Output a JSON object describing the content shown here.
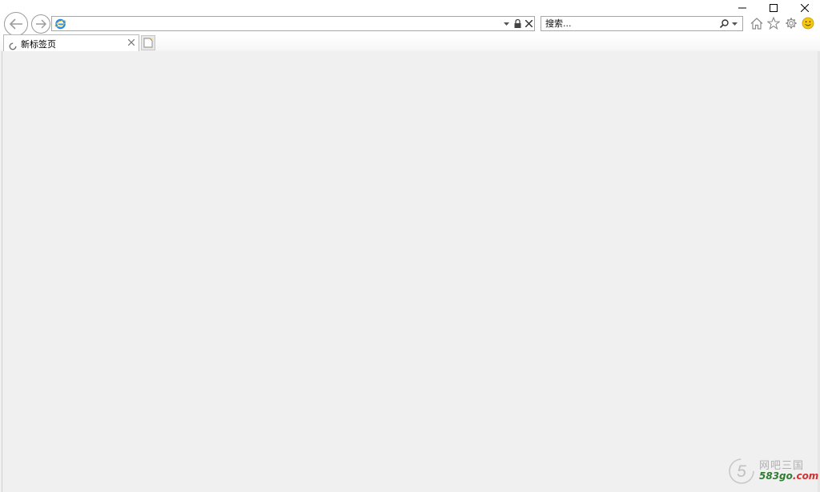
{
  "window": {
    "minimize_icon": "minimize-icon",
    "maximize_icon": "maximize-icon",
    "close_icon": "close-icon"
  },
  "toolbar": {
    "back_icon": "back-arrow-icon",
    "forward_icon": "forward-arrow-icon",
    "address": {
      "value": "",
      "site_icon": "internet-explorer-icon",
      "dropdown_icon": "dropdown-arrow-icon",
      "lock_icon": "lock-icon",
      "stop_icon": "close-icon"
    },
    "search": {
      "placeholder": "搜索...",
      "search_icon": "search-icon",
      "dropdown_icon": "dropdown-arrow-icon"
    },
    "home_icon": "home-icon",
    "favorites_icon": "star-icon",
    "tools_icon": "gear-icon",
    "feedback_icon": "smiley-icon"
  },
  "tabs": [
    {
      "title": "新标签页",
      "loading": true
    }
  ],
  "new_tab_icon": "new-tab-icon",
  "watermark": {
    "logo_glyph": "5",
    "site_name": "网吧三国",
    "url_main": "583go",
    "url_tld": ".com"
  },
  "colors": {
    "ie_blue": "#1e88e5",
    "ie_ring": "#f5b400",
    "smiley": "#f2c811",
    "watermark_green": "#2e7d32",
    "watermark_red": "#d32f2f"
  }
}
